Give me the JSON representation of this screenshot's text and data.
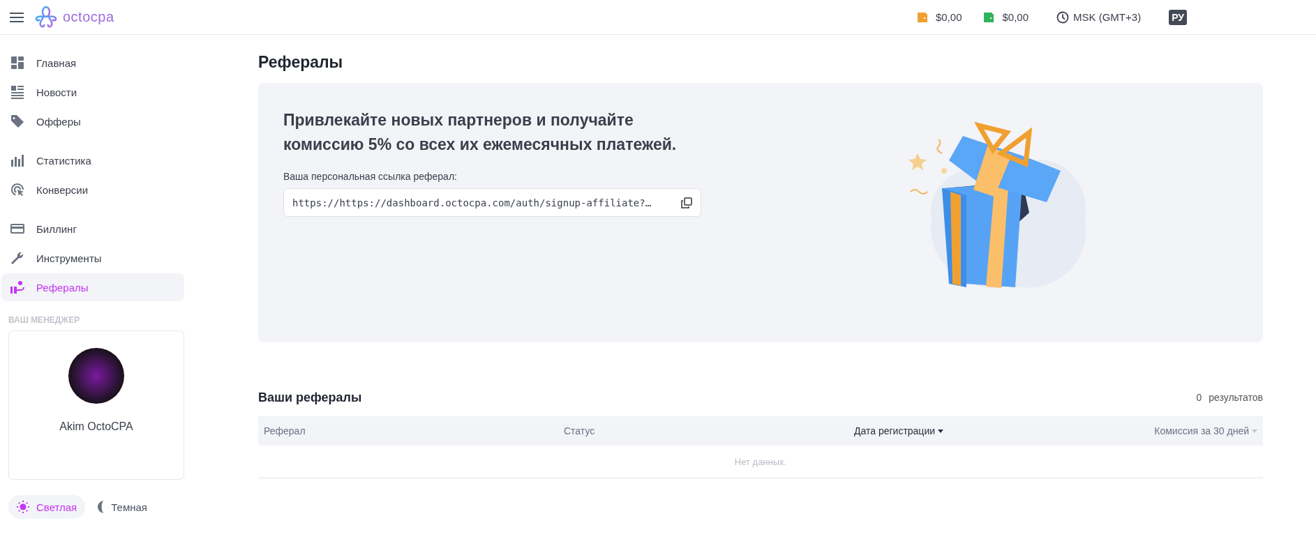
{
  "header": {
    "logo": "octocpa",
    "balances": [
      {
        "amount": "$0,00",
        "color": "#f0a030"
      },
      {
        "amount": "$0,00",
        "color": "#2fb35a"
      }
    ],
    "timezone": "MSK (GMT+3)",
    "language": "РУ"
  },
  "sidebar": {
    "groups": [
      [
        {
          "label": "Главная",
          "selected": false
        },
        {
          "label": "Новости",
          "selected": false
        },
        {
          "label": "Офферы",
          "selected": false
        }
      ],
      [
        {
          "label": "Статистика",
          "selected": false
        },
        {
          "label": "Конверсии",
          "selected": false
        }
      ],
      [
        {
          "label": "Биллинг",
          "selected": false
        },
        {
          "label": "Инструменты",
          "selected": false
        },
        {
          "label": "Рефералы",
          "selected": true
        }
      ]
    ],
    "manager_heading": "ВАШ МЕНЕДЖЕР",
    "manager_name": "Akim OctoCPA",
    "themes": [
      {
        "label": "Светлая",
        "selected": true
      },
      {
        "label": "Темная",
        "selected": false
      }
    ]
  },
  "page_title": "Рефералы",
  "banner": {
    "heading": "Привлекайте новых партнеров и получайте комиссию 5% со всех их ежемесячных платежей.",
    "link_label": "Ваша персональная ссылка реферал:",
    "link_value": "https://https://dashboard.octocpa.com/auth/signup-affiliate?…"
  },
  "referrals": {
    "title": "Ваши рефералы",
    "count": "0",
    "count_label": "результатов",
    "columns": [
      {
        "label": "Реферал",
        "sortable": false,
        "sorted": false
      },
      {
        "label": "Статус",
        "sortable": false,
        "sorted": false
      },
      {
        "label": "Дата регистрации",
        "sortable": true,
        "sorted": true
      },
      {
        "label": "Комиссия за 30 дней",
        "sortable": true,
        "sorted": false
      }
    ],
    "empty_text": "Нет данных."
  }
}
